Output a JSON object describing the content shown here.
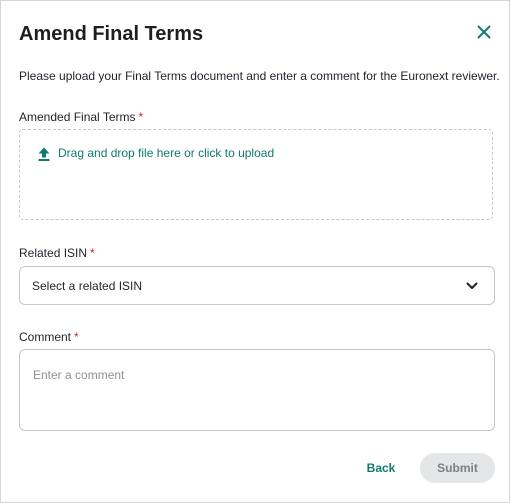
{
  "dialog": {
    "title": "Amend Final Terms",
    "intro": "Please upload your Final Terms document and enter a comment for the Euronext reviewer.",
    "close_icon": "close-icon"
  },
  "upload": {
    "label": "Amended Final Terms",
    "required_mark": "*",
    "dropzone_text": "Drag and drop file here or click to upload",
    "icon": "upload-icon"
  },
  "isin": {
    "label": "Related ISIN",
    "required_mark": "*",
    "placeholder": "Select a related ISIN",
    "icon": "chevron-down-icon"
  },
  "comment": {
    "label": "Comment",
    "required_mark": "*",
    "placeholder": "Enter a comment"
  },
  "actions": {
    "back_label": "Back",
    "submit_label": "Submit",
    "submit_disabled": true
  },
  "colors": {
    "accent": "#0f7b6c",
    "required": "#c62828",
    "border": "#c4c8cc",
    "disabled_bg": "#e4e6e8",
    "disabled_text": "#7b8086"
  }
}
